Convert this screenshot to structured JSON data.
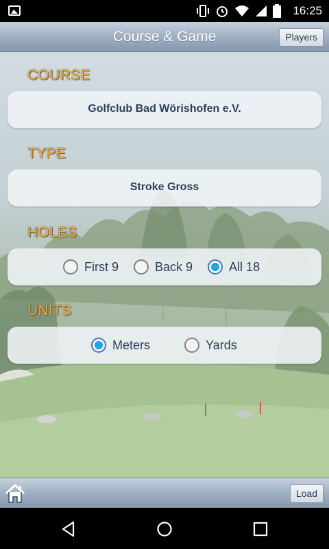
{
  "status_bar": {
    "time": "16:25"
  },
  "header": {
    "title": "Course & Game",
    "players_label": "Players"
  },
  "sections": {
    "course": {
      "label": "COURSE",
      "value": "Golfclub Bad Wörishofen e.V."
    },
    "type": {
      "label": "TYPE",
      "value": "Stroke Gross"
    },
    "holes": {
      "label": "HOLES",
      "options": [
        "First 9",
        "Back 9",
        "All 18"
      ],
      "selected": "All 18"
    },
    "units": {
      "label": "UNITS",
      "options": [
        "Meters",
        "Yards"
      ],
      "selected": "Meters"
    }
  },
  "footer": {
    "load_label": "Load",
    "home_icon": "home-icon"
  },
  "colors": {
    "accent_label": "#e8b04a",
    "radio_selected": "#1ea3e6",
    "text": "#2e3f5c"
  }
}
